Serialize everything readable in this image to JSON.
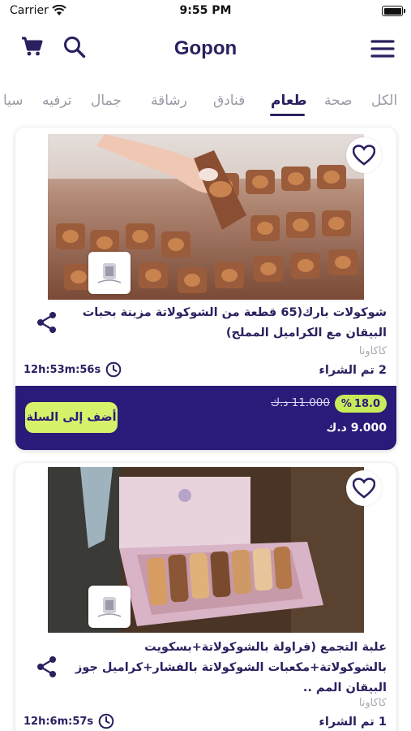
{
  "status": {
    "carrier": "Carrier",
    "time": "9:55 PM"
  },
  "header": {
    "title": "Gopon"
  },
  "tabs": [
    {
      "label": "الكل"
    },
    {
      "label": "صحة"
    },
    {
      "label": "طعام"
    },
    {
      "label": "فنادق"
    },
    {
      "label": "رشاقة"
    },
    {
      "label": "جمال"
    },
    {
      "label": "ترفيه"
    },
    {
      "label": "سيا"
    }
  ],
  "active_tab": "طعام",
  "products": [
    {
      "name": "شوكولات بارك(65 قطعة من الشوكولاتة مزينة بحبات البيقان مع الكراميل المملح)",
      "brand": "كاكاونا",
      "bought": "2 تم الشراء",
      "timer": "12h:53m:56s",
      "discount_pct": "18.0",
      "discount_symbol": "%",
      "old_price": "11.000 د.ك",
      "new_price": "9.000 د.ك",
      "add_to_cart": "أضف إلى السلة"
    },
    {
      "name": "علبة التجمع (فراولة بالشوكولاتة+بسكويت بالشوكولاتة+مكعبات الشوكولاتة بالفشار+كراميل جوز البيقان المم ..",
      "brand": "كاكاونا",
      "bought": "1 تم الشراء",
      "timer": "12h:6m:57s"
    }
  ],
  "colors": {
    "primary": "#2a1b7a",
    "accent": "#d6f26a",
    "text": "#2a2160"
  }
}
